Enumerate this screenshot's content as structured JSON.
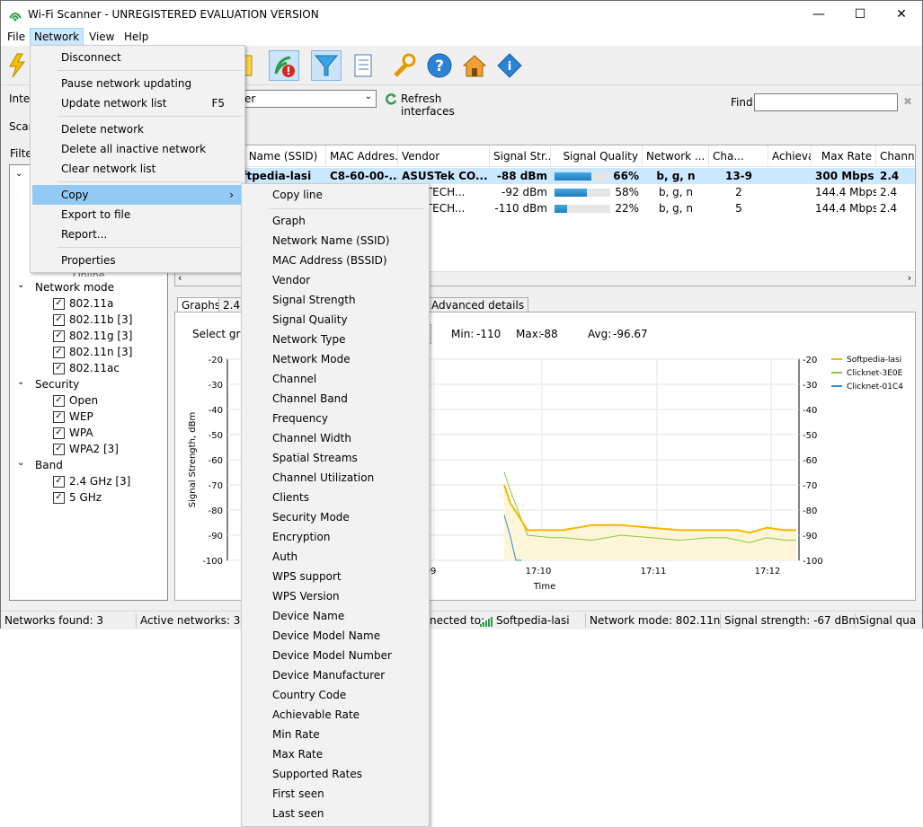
{
  "window": {
    "title": "Wi-Fi Scanner - UNREGISTERED EVALUATION VERSION",
    "minimize": "—",
    "maximize": "☐",
    "close": "✕"
  },
  "menubar": {
    "file": "File",
    "network": "Network",
    "view": "View",
    "help": "Help"
  },
  "toolbar": {
    "interfaces_label": "Interf",
    "combo_value": "er",
    "refresh": "Refresh interfaces",
    "find_label": "Find:",
    "find_clear": "✖"
  },
  "scan_tab": "Scan",
  "filter_label": "Filter",
  "tree": {
    "online_label": "Online",
    "groups": [
      {
        "label": "Network mode",
        "items": [
          "802.11a",
          "802.11b [3]",
          "802.11g [3]",
          "802.11n [3]",
          "802.11ac"
        ]
      },
      {
        "label": "Security",
        "items": [
          "Open",
          "WEP",
          "WPA",
          "WPA2 [3]"
        ]
      },
      {
        "label": "Band",
        "items": [
          "2.4 GHz [3]",
          "5 GHz"
        ]
      }
    ]
  },
  "grid": {
    "headers": [
      "rk Name (SSID)",
      "MAC Addres...",
      "Vendor",
      "Signal Str...",
      "Signal Quality",
      "Network ...",
      "Cha...",
      "Achievable ...",
      "Max Rate",
      "Chann"
    ],
    "rows": [
      {
        "ssid": "oftpedia-lasi",
        "mac": "C8-60-00-...",
        "vendor": "ASUSTek CO...",
        "signal": "-88 dBm",
        "quality": "66%",
        "quality_value": 66,
        "mode": "b, g, n",
        "channel": "13-9",
        "achievable": "",
        "maxrate": "300 Mbps",
        "chan": "2.4",
        "bold": true
      },
      {
        "ssid": "",
        "mac": "",
        "vendor": "WEI TECH...",
        "signal": "-92 dBm",
        "quality": "58%",
        "quality_value": 58,
        "mode": "b, g, n",
        "channel": "2",
        "achievable": "",
        "maxrate": "144.4 Mbps",
        "chan": "2.4",
        "bold": false
      },
      {
        "ssid": "",
        "mac": "",
        "vendor": "WEI TECH...",
        "signal": "-110 dBm",
        "quality": "22%",
        "quality_value": 22,
        "mode": "b, g, n",
        "channel": "5",
        "achievable": "",
        "maxrate": "144.4 Mbps",
        "chan": "2.4",
        "bold": false
      }
    ]
  },
  "detail_tabs": {
    "graphs": "Graphs",
    "band": "2.4",
    "advanced": "Advanced details"
  },
  "graph_toolbar": {
    "select_label": "Select grap",
    "min_label": "Min:",
    "min_value": "-110",
    "max_label": "Max:",
    "max_value": "-88",
    "avg_label": "Avg:",
    "avg_value": "-96.67"
  },
  "chart_data": {
    "type": "line",
    "xlabel": "Time",
    "ylabel": "Signal Strength, dBm",
    "ylim": [
      -100,
      -20
    ],
    "yticks": [
      -20,
      -30,
      -40,
      -50,
      -60,
      -70,
      -80,
      -90,
      -100
    ],
    "xticks": [
      "09",
      "17:10",
      "17:11",
      "17:12"
    ],
    "legend_position": "right",
    "series": [
      {
        "name": "Softpedia-lasi",
        "color": "#f5b800",
        "x": [
          0.0,
          0.1,
          0.4,
          0.8,
          1.0,
          1.5,
          2.0,
          2.5,
          3.0,
          3.5,
          3.8,
          4.0,
          4.2,
          4.5,
          4.8,
          5.0
        ],
        "values": [
          -70,
          -77,
          -88,
          -88,
          -88,
          -86,
          -86,
          -87,
          -88,
          -88,
          -88,
          -88,
          -89,
          -87,
          -88,
          -88
        ]
      },
      {
        "name": "Clicknet-3E0E",
        "color": "#8cc63f",
        "x": [
          0.0,
          0.1,
          0.4,
          0.8,
          1.0,
          1.5,
          2.0,
          2.5,
          3.0,
          3.5,
          3.8,
          4.0,
          4.2,
          4.5,
          4.8,
          5.0
        ],
        "values": [
          -65,
          -72,
          -90,
          -91,
          -91,
          -92,
          -90,
          -91,
          -92,
          -91,
          -91,
          -92,
          -93,
          -91,
          -92,
          -92
        ]
      },
      {
        "name": "Clicknet-01C4",
        "color": "#2b8fd6",
        "x": [
          0.0,
          0.1,
          0.2,
          0.3
        ],
        "values": [
          -82,
          -90,
          -100,
          -100
        ]
      }
    ]
  },
  "statusbar": {
    "found": "Networks found: 3",
    "active": "Active networks: 3",
    "connected_prefix": "nected to:",
    "connected_name": "Softpedia-lasi",
    "mode": "Network mode: 802.11n",
    "signal": "Signal strength: -67 dBm",
    "quality": "Signal qua"
  },
  "network_menu": {
    "items": [
      {
        "label": "Disconnect"
      },
      {
        "label": "Pause network updating"
      },
      {
        "label": "Update network list",
        "shortcut": "F5"
      },
      {
        "label": "Delete network"
      },
      {
        "label": "Delete all inactive network"
      },
      {
        "label": "Clear network list"
      },
      {
        "label": "Copy",
        "arrow": "›"
      },
      {
        "label": "Export to file"
      },
      {
        "label": "Report..."
      },
      {
        "label": "Properties"
      }
    ]
  },
  "copy_menu": {
    "copy_line": "Copy line",
    "items": [
      "Graph",
      "Network Name (SSID)",
      "MAC Address (BSSID)",
      "Vendor",
      "Signal Strength",
      "Signal Quality",
      "Network Type",
      "Network Mode",
      "Channel",
      "Channel Band",
      "Frequency",
      "Channel Width",
      "Spatial Streams",
      "Channel Utilization",
      "Clients",
      "Security Mode",
      "Encryption",
      "Auth",
      "WPS support",
      "WPS Version",
      "Device Name",
      "Device Model Name",
      "Device Model Number",
      "Device Manufacturer",
      "Country Code",
      "Achievable Rate",
      "Min Rate",
      "Max Rate",
      "Supported Rates",
      "First seen",
      "Last seen"
    ]
  },
  "colors": {
    "accent": "#0078d7",
    "menu_highlight": "#91c9f7",
    "selected_row": "#cce8ff"
  }
}
